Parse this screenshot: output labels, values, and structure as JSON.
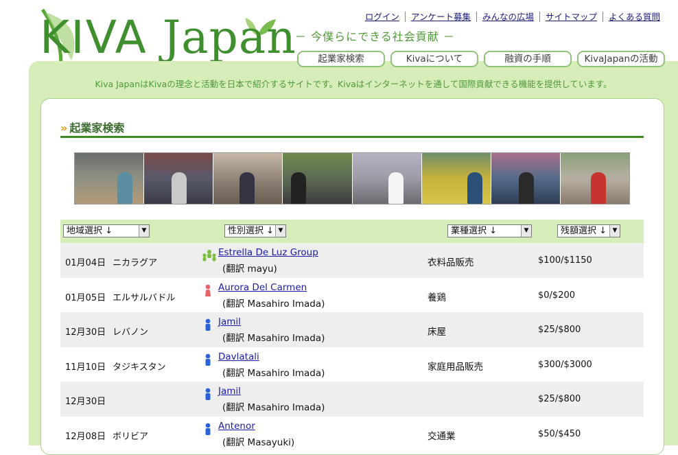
{
  "header": {
    "logo_text_prefix": "KIVA",
    "logo_text_suffix": "Japan",
    "tagline": "－ 今僕らにできる社会貢献 －",
    "top_links": [
      "ログイン",
      "アンケート募集",
      "みんなの広場",
      "サイトマップ",
      "よくある質問"
    ],
    "nav_tabs": [
      "起業家検索",
      "Kivaについて",
      "融資の手順",
      "KivaJapanの活動"
    ]
  },
  "intro": "Kiva JapanはKivaの理念と活動を日本で紹介するサイトです。Kivaはインターネットを通して国際貢献できる機能を提供しています。",
  "section": {
    "chevrons": "»",
    "title": "起業家検索"
  },
  "filters": {
    "region": "地域選択 ↓",
    "gender": "性別選択 ↓",
    "sector": "業種選択 ↓",
    "remaining": "残額選択 ↓"
  },
  "rows": [
    {
      "date": "01月04日",
      "country": "ニカラグア",
      "icon": "group-icon",
      "name": "Estrella De Luz Group",
      "translator": "(翻訳 mayu)",
      "sector": "衣料品販売",
      "amount": "$100/$1150"
    },
    {
      "date": "01月05日",
      "country": "エルサルバドル",
      "icon": "female-icon",
      "name": "Aurora Del Carmen",
      "translator": "(翻訳 Masahiro Imada)",
      "sector": "養鶏",
      "amount": "$0/$200"
    },
    {
      "date": "12月30日",
      "country": "レバノン",
      "icon": "male-icon",
      "name": "Jamil",
      "translator": "(翻訳 Masahiro Imada)",
      "sector": "床屋",
      "amount": "$25/$800"
    },
    {
      "date": "11月10日",
      "country": "タジキスタン",
      "icon": "male-icon",
      "name": "Davlatali",
      "translator": "(翻訳 Masahiro Imada)",
      "sector": "家庭用品販売",
      "amount": "$300/$3000"
    },
    {
      "date": "12月30日",
      "country": "",
      "icon": "male-icon",
      "name": "Jamil",
      "translator": "(翻訳 Masahiro Imada)",
      "sector": "",
      "amount": "$25/$800"
    },
    {
      "date": "12月08日",
      "country": "ボリビア",
      "icon": "male-icon",
      "name": "Antenor",
      "translator": "(翻訳 Masayuki)",
      "sector": "交通業",
      "amount": "$50/$450"
    }
  ],
  "colors": {
    "brand_green": "#3f8f2f",
    "frame_green": "#d6ecb9",
    "link_blue": "#1a1aaa"
  }
}
